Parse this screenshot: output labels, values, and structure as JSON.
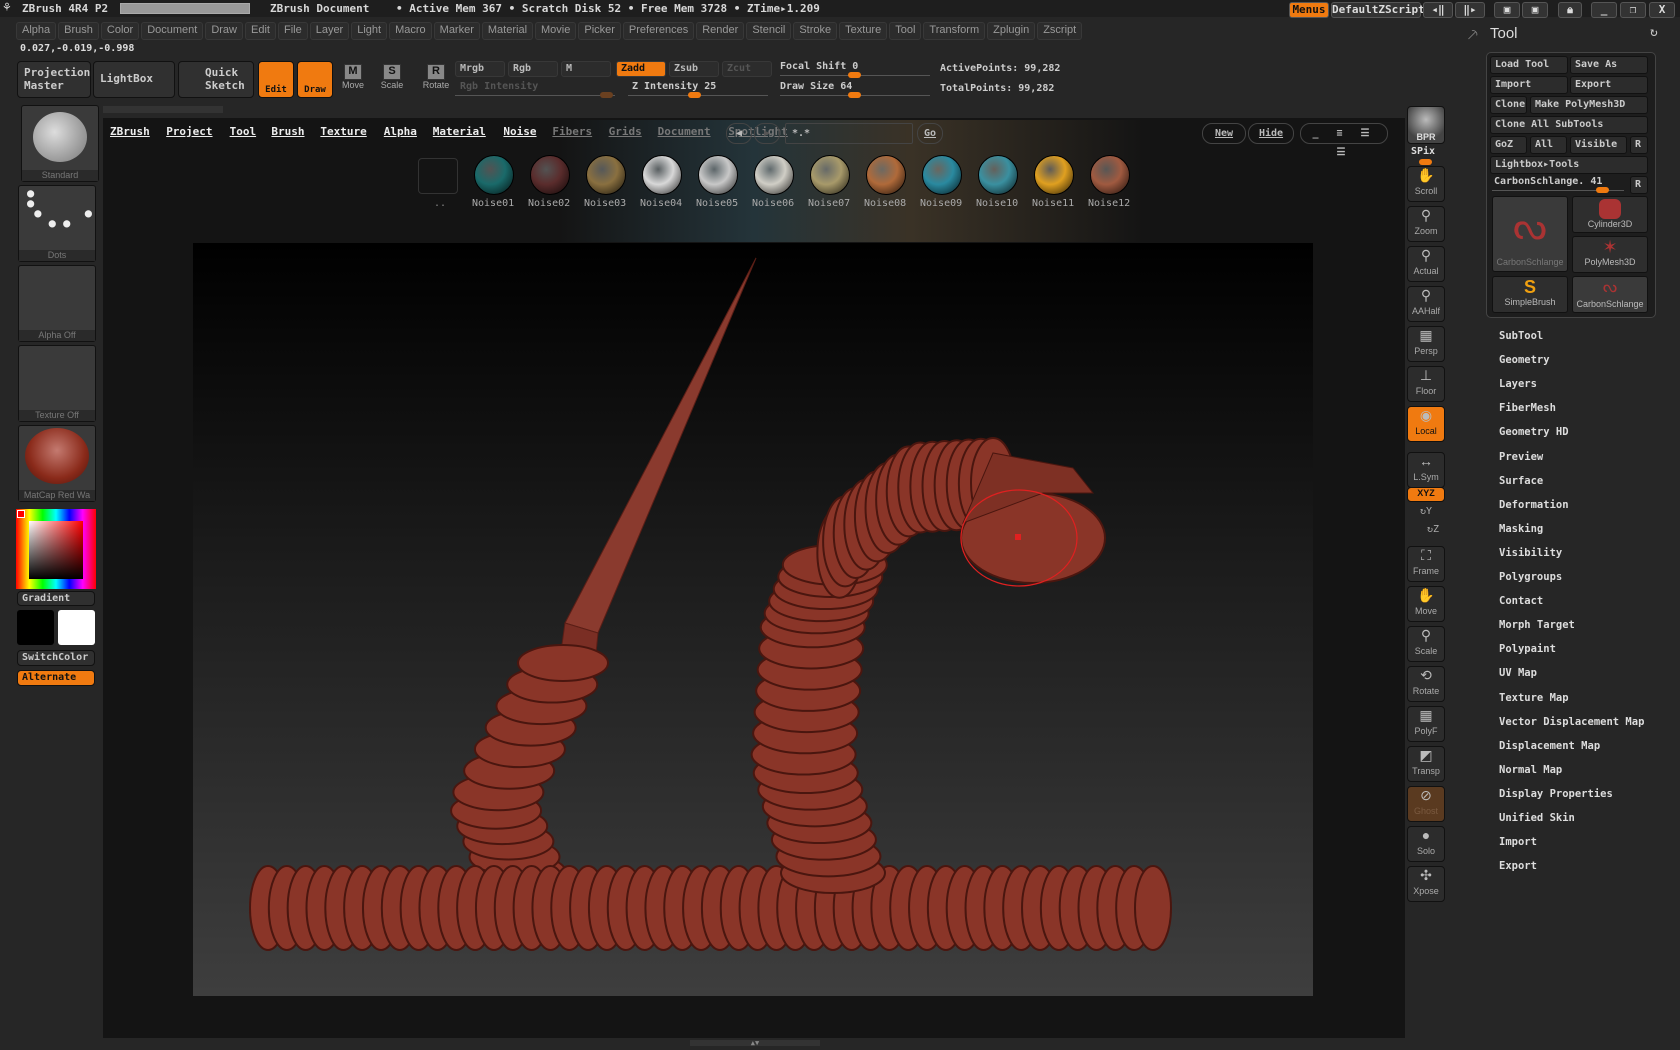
{
  "titlebar": {
    "app": "ZBrush 4R4 P2",
    "document": "ZBrush Document",
    "status": "• Active Mem 367 • Scratch Disk 52 • Free Mem 3728 • ZTime▸1.209",
    "menus": "Menus",
    "script": "DefaultZScript"
  },
  "menu": [
    "Alpha",
    "Brush",
    "Color",
    "Document",
    "Draw",
    "Edit",
    "File",
    "Layer",
    "Light",
    "Macro",
    "Marker",
    "Material",
    "Movie",
    "Picker",
    "Preferences",
    "Render",
    "Stencil",
    "Stroke",
    "Texture",
    "Tool",
    "Transform",
    "Zplugin",
    "Zscript"
  ],
  "coords": "0.027,-0.019,-0.998",
  "shelf": {
    "projection_master": "Projection Master",
    "lightbox": "LightBox",
    "quick_sketch": "Quick Sketch",
    "edit": "Edit",
    "draw": "Draw",
    "move": "Move",
    "scale": "Scale",
    "rotate": "Rotate",
    "mrgb": "Mrgb",
    "rgb": "Rgb",
    "m": "M",
    "zadd": "Zadd",
    "zsub": "Zsub",
    "zcut": "Zcut",
    "rgb_intensity": "Rgb Intensity",
    "z_intensity": "Z Intensity 25",
    "focal_shift": "Focal Shift 0",
    "draw_size": "Draw Size 64",
    "active_points": "ActivePoints: 99,282",
    "total_points": "TotalPoints: 99,282"
  },
  "values": {
    "z_intensity": 25,
    "focal_shift": 0,
    "draw_size": 64
  },
  "lightbox": {
    "tabs": [
      "ZBrush",
      "Project",
      "Tool",
      "Brush",
      "Texture",
      "Alpha",
      "Material",
      "Noise",
      "Fibers",
      "Grids",
      "Document",
      "Spotlight"
    ],
    "active_tab": "Noise",
    "search": "*.*",
    "go": "Go",
    "new": "New",
    "hide": "Hide",
    "folder_label": "..",
    "items": [
      {
        "label": "Noise01",
        "color": "#1a6a6a"
      },
      {
        "label": "Noise02",
        "color": "#5a2c2c"
      },
      {
        "label": "Noise03",
        "color": "#8a7040"
      },
      {
        "label": "Noise04",
        "color": "#d8d8d8"
      },
      {
        "label": "Noise05",
        "color": "#c8c8c8"
      },
      {
        "label": "Noise06",
        "color": "#d0cec6"
      },
      {
        "label": "Noise07",
        "color": "#a89a6a"
      },
      {
        "label": "Noise08",
        "color": "#b06a3a"
      },
      {
        "label": "Noise09",
        "color": "#2a8aa0"
      },
      {
        "label": "Noise10",
        "color": "#3a90a0"
      },
      {
        "label": "Noise11",
        "color": "#e0a020"
      },
      {
        "label": "Noise12",
        "color": "#a05a40"
      }
    ]
  },
  "left": {
    "brush": "Standard",
    "stroke": "Dots",
    "alpha": "Alpha Off",
    "texture": "Texture Off",
    "material": "MatCap Red Wa",
    "gradient": "Gradient",
    "switch_color": "SwitchColor",
    "alternate": "Alternate"
  },
  "rshelf": [
    {
      "label": "Scroll",
      "icon": "hand-icon"
    },
    {
      "label": "Zoom",
      "icon": "magnifier-icon"
    },
    {
      "label": "Actual",
      "icon": "magnifier-icon"
    },
    {
      "label": "AAHalf",
      "icon": "magnifier-icon"
    },
    {
      "label": "Persp",
      "icon": "grid-icon"
    },
    {
      "label": "Floor",
      "icon": "floor-icon"
    },
    {
      "label": "Local",
      "icon": "local-icon"
    },
    {
      "label": "L.Sym",
      "icon": "sym-icon"
    }
  ],
  "rshelf2": [
    {
      "label": "Frame",
      "icon": "frame-icon"
    },
    {
      "label": "Move",
      "icon": "hand-icon"
    },
    {
      "label": "Scale",
      "icon": "magnifier-icon"
    },
    {
      "label": "Rotate",
      "icon": "rotate-icon"
    },
    {
      "label": "PolyF",
      "icon": "grid-icon"
    },
    {
      "label": "Transp",
      "icon": "transp-icon"
    },
    {
      "label": "Ghost",
      "icon": "ghost-icon"
    },
    {
      "label": "Solo",
      "icon": "solo-icon"
    },
    {
      "label": "Xpose",
      "icon": "xpose-icon"
    }
  ],
  "bpr": "BPR",
  "spix": "SPix",
  "xyz": "XYZ",
  "ry": "Y",
  "rz": "Z",
  "tool": {
    "title": "Tool",
    "load": "Load Tool",
    "save_as": "Save As",
    "import": "Import",
    "export": "Export",
    "clone": "Clone",
    "make_polymesh": "Make PolyMesh3D",
    "clone_all": "Clone All SubTools",
    "goz": "GoZ",
    "all": "All",
    "visible": "Visible",
    "r": "R",
    "lightbox_tools": "Lightbox▸Tools",
    "current": "CarbonSchlange. 41",
    "tools": [
      "CarbonSchlange",
      "Cylinder3D",
      "PolyMesh3D",
      "SimpleBrush",
      "CarbonSchlange"
    ],
    "sections": [
      "SubTool",
      "Geometry",
      "Layers",
      "FiberMesh",
      "Geometry HD",
      "Preview",
      "Surface",
      "Deformation",
      "Masking",
      "Visibility",
      "Polygroups",
      "Contact",
      "Morph Target",
      "Polypaint",
      "UV Map",
      "Texture Map",
      "Vector Displacement Map",
      "Displacement Map",
      "Normal Map",
      "Display Properties",
      "Unified Skin",
      "Import",
      "Export"
    ]
  },
  "colors": {
    "accent": "#f07a10",
    "model": "#8a3528"
  }
}
